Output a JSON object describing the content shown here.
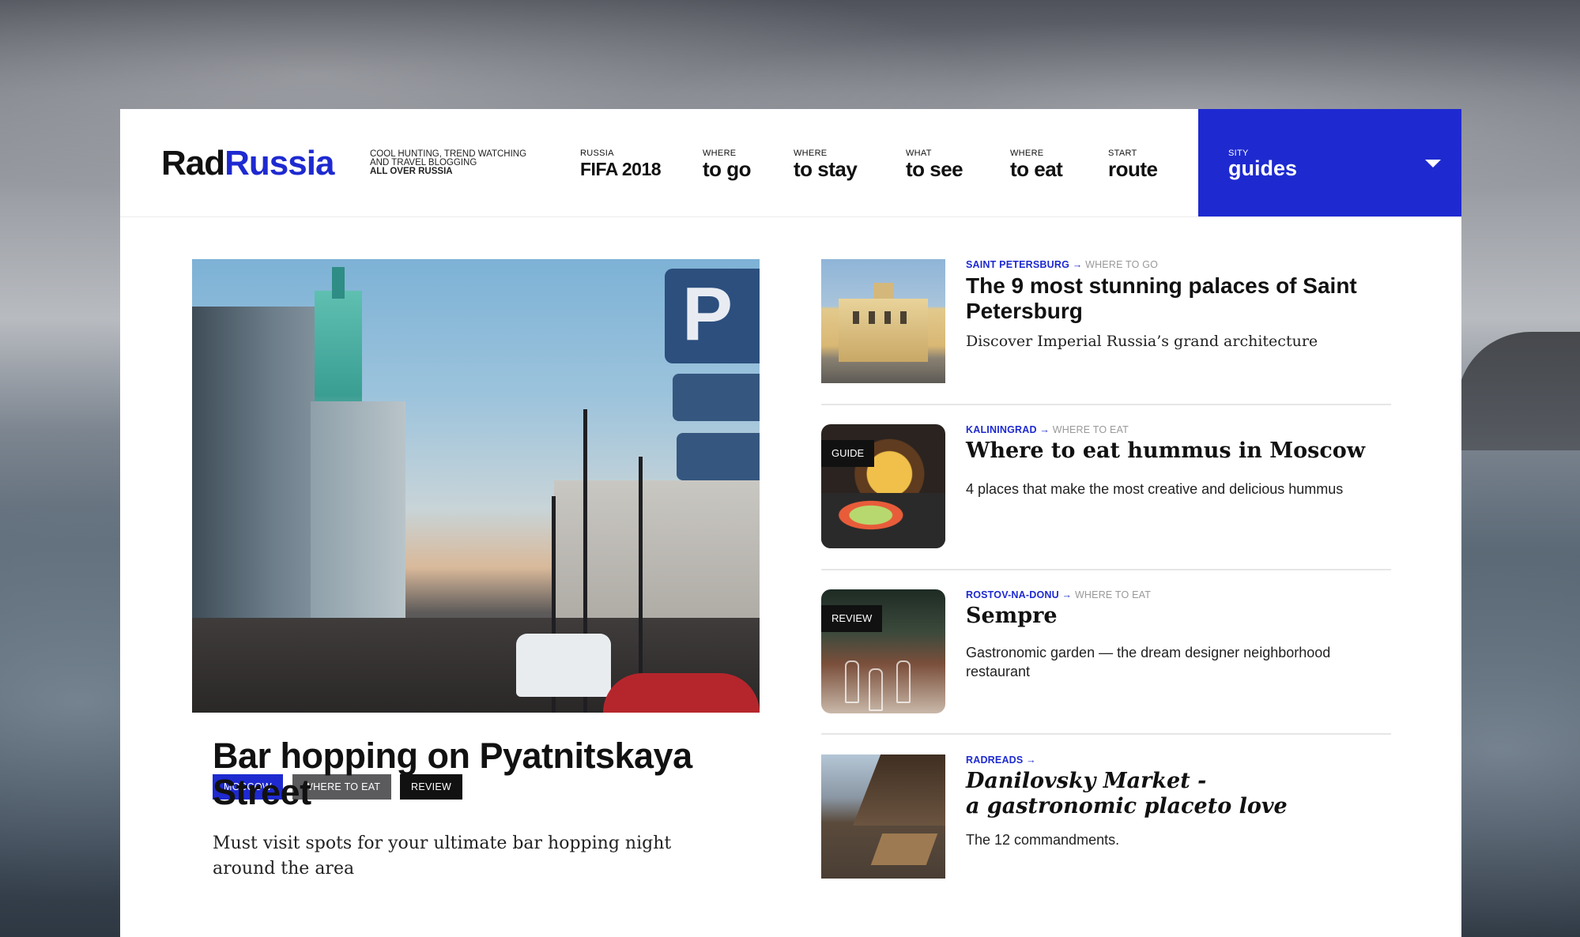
{
  "header": {
    "logo": {
      "part1": "Rad",
      "part2": "Russia"
    },
    "tagline": {
      "line1": "COOL HUNTING, TREND WATCHING",
      "line2": "AND TRAVEL BLOGGING",
      "line3": "ALL OVER RUSSIA"
    },
    "nav": [
      {
        "small": "RUSSIA",
        "big": "FIFA 2018"
      },
      {
        "small": "WHERE",
        "big": "to go"
      },
      {
        "small": "WHERE",
        "big": "to stay"
      },
      {
        "small": "WHAT",
        "big": "to see"
      },
      {
        "small": "WHERE",
        "big": "to eat"
      },
      {
        "small": "START",
        "big": "route"
      }
    ],
    "guides": {
      "small": "SITY",
      "big": "guides"
    }
  },
  "featured": {
    "tags": [
      "MOSCOW",
      "WHERE TO EAT",
      "REVIEW"
    ],
    "title": "Bar hopping on Pyatnitskaya Street",
    "subtitle": "Must visit spots for your ultimate bar hopping night around the area",
    "image_sign": "P"
  },
  "stories": [
    {
      "city": "SAINT PETERSBURG",
      "arrow": "→",
      "category": "WHERE TO GO",
      "title": "The 9 most stunning palaces of Saint Petersburg",
      "desc": "Discover Imperial Russia’s grand architecture",
      "badge": ""
    },
    {
      "city": "KALININGRAD",
      "arrow": "→",
      "category": "WHERE TO EAT",
      "title": "Where to eat hummus in Moscow",
      "desc": "4 places that make the most creative and delicious hummus",
      "badge": "GUIDE"
    },
    {
      "city": "ROSTOV-NA-DONU",
      "arrow": "→",
      "category": "WHERE TO EAT",
      "title": "Sempre",
      "desc": "Gastronomic garden — the dream designer neighborhood restaurant",
      "badge": "REVIEW"
    },
    {
      "city": "RADREADS",
      "arrow": "→",
      "category": "",
      "title_line1": "Danilovsky Market -",
      "title_line2": "a gastronomic placeto love",
      "desc": "The 12 commandments.",
      "badge": ""
    }
  ],
  "colors": {
    "accent": "#1e2ad0",
    "text": "#111111",
    "muted": "#999999"
  }
}
